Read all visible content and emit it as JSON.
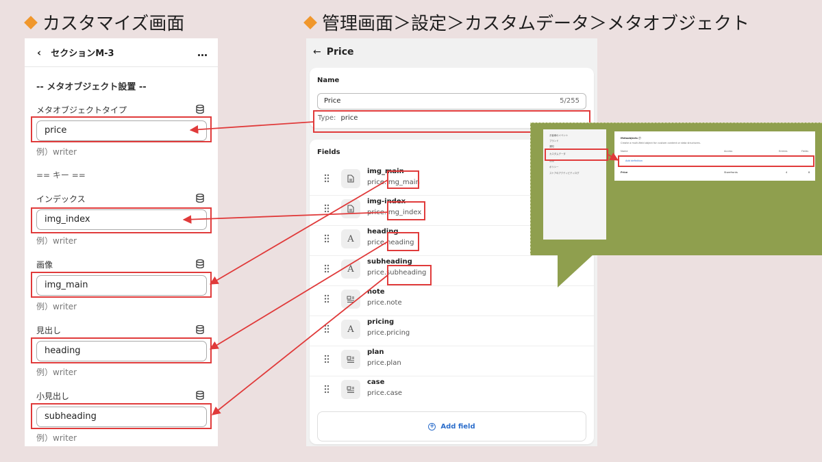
{
  "headings": {
    "left": "カスタマイズ画面",
    "right": "管理画面＞設定＞カスタムデータ＞メタオブジェクト"
  },
  "left_panel": {
    "back_icon": "chevron-left-icon",
    "title": "セクションM-3",
    "more_icon": "ellipsis-icon",
    "section_title": "-- メタオブジェクト設置 --",
    "key_divider": "== キー ==",
    "fields": [
      {
        "label": "メタオブジェクトタイプ",
        "value": "price",
        "example": "例）writer"
      },
      {
        "label": "インデックス",
        "value": "img_index",
        "example": "例）writer"
      },
      {
        "label": "画像",
        "value": "img_main",
        "example": "例）writer"
      },
      {
        "label": "見出し",
        "value": "heading",
        "example": "例）writer"
      },
      {
        "label": "小見出し",
        "value": "subheading",
        "example": "例）writer"
      }
    ]
  },
  "right_panel": {
    "back_icon": "arrow-left-icon",
    "title": "Price",
    "name_label": "Name",
    "name_value": "Price",
    "name_count": "5/255",
    "type_label": "Type:",
    "type_value": "price",
    "fields_label": "Fields",
    "fields": [
      {
        "name": "img_main",
        "key": "price.img_main",
        "icon": "file-icon"
      },
      {
        "name": "img-index",
        "key": "price.img_index",
        "icon": "file-icon"
      },
      {
        "name": "heading",
        "key": "price.heading",
        "icon": "text-icon"
      },
      {
        "name": "subheading",
        "key": "price.subheading",
        "icon": "text-icon"
      },
      {
        "name": "note",
        "key": "price.note",
        "icon": "rich-text-icon"
      },
      {
        "name": "pricing",
        "key": "price.pricing",
        "icon": "text-icon"
      },
      {
        "name": "plan",
        "key": "price.plan",
        "icon": "rich-text-icon"
      },
      {
        "name": "case",
        "key": "price.case",
        "icon": "rich-text-icon"
      }
    ],
    "add_field": "Add field"
  },
  "thumbnail": {
    "nav_items": [
      "お客様のイベント",
      "ブランド",
      "通知",
      "カスタムデータ",
      "言語",
      "ポリシー",
      "ストアのアクティビティログ"
    ],
    "title": "Metaobjects ⓘ",
    "description": "Create a multi-field object for custom content or data structures.",
    "columns": [
      "Name",
      "Access",
      "Entries",
      "Fields"
    ],
    "add_definition": "Add definition",
    "row": {
      "name": "Price",
      "access": "Storefronts",
      "entries": "4",
      "fields": "8"
    }
  },
  "colors": {
    "background": "#ece0e0",
    "highlight_red": "#e03a3a",
    "bullet_orange": "#f0972c",
    "callout_green": "#8f9f4e",
    "link_blue": "#2c6ecb"
  }
}
